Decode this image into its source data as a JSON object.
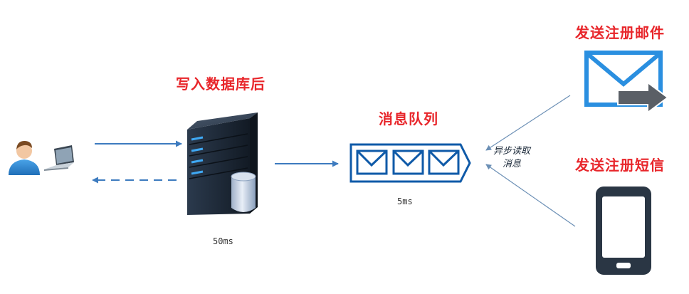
{
  "labels": {
    "db_write": "写入数据库后",
    "mq": "消息队列",
    "email": "发送注册邮件",
    "sms": "发送注册短信",
    "async_line1": "异步读取",
    "async_line2": "消息",
    "time_server": "50ms",
    "time_mq": "5ms"
  },
  "colors": {
    "label_red": "#e8262b",
    "arrow_blue": "#3d7bbf",
    "queue_blue": "#0f5aa8",
    "email_blue": "#2a8fe0",
    "server_dark": "#1f2a38",
    "phone_dark": "#2a3644"
  },
  "icons": [
    "user-icon",
    "laptop-icon",
    "server-icon",
    "database-icon",
    "message-queue-icon",
    "email-icon",
    "send-arrow-icon",
    "phone-icon"
  ]
}
